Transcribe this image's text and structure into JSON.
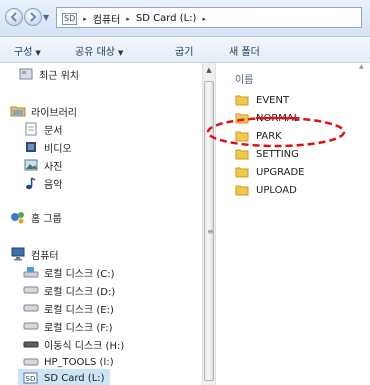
{
  "address": {
    "segments": [
      "컴퓨터",
      "SD Card (L:)"
    ],
    "drive_badge": "SD",
    "separator": "▸"
  },
  "toolbar": {
    "organize": "구성",
    "share": "공유 대상",
    "burn": "굽기",
    "new_folder": "새 폴더",
    "dropdown_glyph": "▼"
  },
  "nav": {
    "items": [
      {
        "label": "최근 위치",
        "icon": "recent-places-icon"
      },
      {
        "label": "라이브러리",
        "icon": "libraries-icon"
      },
      {
        "label": "문서",
        "icon": "documents-icon"
      },
      {
        "label": "비디오",
        "icon": "videos-icon"
      },
      {
        "label": "사진",
        "icon": "pictures-icon"
      },
      {
        "label": "음악",
        "icon": "music-icon"
      },
      {
        "label": "홈 그룹",
        "icon": "homegroup-icon"
      },
      {
        "label": "컴퓨터",
        "icon": "computer-icon"
      },
      {
        "label": "로컬 디스크 (C:)",
        "icon": "system-drive-icon"
      },
      {
        "label": "로컬 디스크 (D:)",
        "icon": "drive-icon"
      },
      {
        "label": "로컬 디스크 (E:)",
        "icon": "drive-icon"
      },
      {
        "label": "로컬 디스크 (F:)",
        "icon": "drive-icon"
      },
      {
        "label": "이동식 디스크 (H:)",
        "icon": "removable-drive-icon"
      },
      {
        "label": "HP_TOOLS (I:)",
        "icon": "drive-icon"
      },
      {
        "label": "SD Card (L:)",
        "icon": "sd-card-icon",
        "selected": true
      }
    ]
  },
  "content": {
    "column_header": "이름",
    "files": [
      {
        "name": "EVENT",
        "icon": "folder-icon"
      },
      {
        "name": "NORMAL",
        "icon": "folder-icon",
        "struck_through": true
      },
      {
        "name": "PARK",
        "icon": "folder-icon",
        "circled": true
      },
      {
        "name": "SETTING",
        "icon": "folder-icon"
      },
      {
        "name": "UPGRADE",
        "icon": "folder-icon"
      },
      {
        "name": "UPLOAD",
        "icon": "folder-icon"
      }
    ]
  },
  "colors": {
    "annotation": "#e01010",
    "folder": "#f2c84b",
    "selection": "#cce4f7",
    "toolbar_text": "#1e395b"
  }
}
